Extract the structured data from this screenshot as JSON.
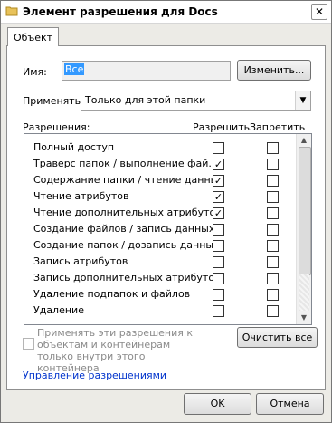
{
  "window": {
    "title": "Элемент разрешения для Docs",
    "close_symbol": "✕"
  },
  "tab": {
    "label": "Объект"
  },
  "name": {
    "label": "Имя:",
    "value": "Все",
    "change_button": "Изменить..."
  },
  "apply_to": {
    "label": "Применять:",
    "value": "Только для этой папки"
  },
  "permissions": {
    "header": "Разрешения:",
    "allow_header": "Разрешить",
    "deny_header": "Запретить",
    "items": [
      {
        "name": "Полный доступ",
        "allow": false,
        "deny": false
      },
      {
        "name": "Траверс папок / выполнение фай...",
        "allow": true,
        "deny": false
      },
      {
        "name": "Содержание папки / чтение данных",
        "allow": true,
        "deny": false
      },
      {
        "name": "Чтение атрибутов",
        "allow": true,
        "deny": false
      },
      {
        "name": "Чтение дополнительных атрибутов",
        "allow": true,
        "deny": false
      },
      {
        "name": "Создание файлов / запись данных",
        "allow": false,
        "deny": false
      },
      {
        "name": "Создание папок / дозапись данных",
        "allow": false,
        "deny": false
      },
      {
        "name": "Запись атрибутов",
        "allow": false,
        "deny": false
      },
      {
        "name": "Запись дополнительных атрибутов",
        "allow": false,
        "deny": false
      },
      {
        "name": "Удаление подпапок и файлов",
        "allow": false,
        "deny": false
      },
      {
        "name": "Удаление",
        "allow": false,
        "deny": false
      }
    ]
  },
  "apply_inheritance": {
    "text": "Применять эти разрешения к объектам и контейнерам только внутри этого контейнера",
    "checked": false
  },
  "clear_all_button": "Очистить все",
  "manage_link": "Управление разрешениями",
  "ok_button": "OK",
  "cancel_button": "Отмена"
}
